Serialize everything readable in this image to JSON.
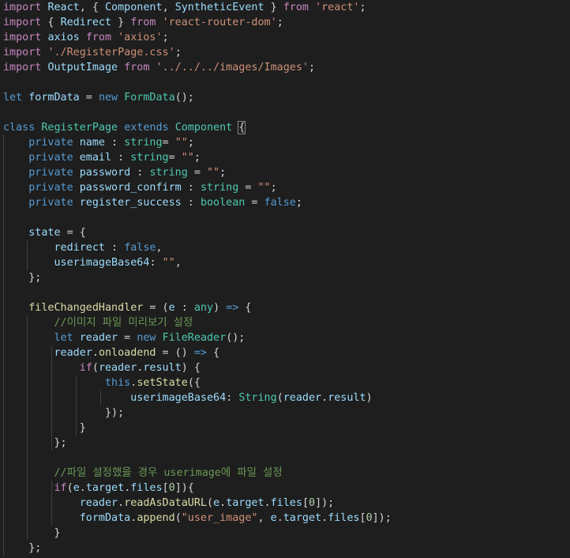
{
  "editor": {
    "lines": [
      [
        [
          "kw1",
          "import"
        ],
        [
          "pu",
          " "
        ],
        [
          "var",
          "React"
        ],
        [
          "pu",
          ", { "
        ],
        [
          "var",
          "Component"
        ],
        [
          "pu",
          ", "
        ],
        [
          "var",
          "SyntheticEvent"
        ],
        [
          "pu",
          " } "
        ],
        [
          "kw1",
          "from"
        ],
        [
          "pu",
          " "
        ],
        [
          "str",
          "'react'"
        ],
        [
          "pu",
          ";"
        ]
      ],
      [
        [
          "kw1",
          "import"
        ],
        [
          "pu",
          " { "
        ],
        [
          "var",
          "Redirect"
        ],
        [
          "pu",
          " } "
        ],
        [
          "kw1",
          "from"
        ],
        [
          "pu",
          " "
        ],
        [
          "str",
          "'react-router-dom'"
        ],
        [
          "pu",
          ";"
        ]
      ],
      [
        [
          "kw1",
          "import"
        ],
        [
          "pu",
          " "
        ],
        [
          "var",
          "axios"
        ],
        [
          "pu",
          " "
        ],
        [
          "kw1",
          "from"
        ],
        [
          "pu",
          " "
        ],
        [
          "str",
          "'axios'"
        ],
        [
          "pu",
          ";"
        ]
      ],
      [
        [
          "kw1",
          "import"
        ],
        [
          "pu",
          " "
        ],
        [
          "str",
          "'./RegisterPage.css'"
        ],
        [
          "pu",
          ";"
        ]
      ],
      [
        [
          "kw1",
          "import"
        ],
        [
          "pu",
          " "
        ],
        [
          "var",
          "OutputImage"
        ],
        [
          "pu",
          " "
        ],
        [
          "kw1",
          "from"
        ],
        [
          "pu",
          " "
        ],
        [
          "str",
          "'../../../images/Images'"
        ],
        [
          "pu",
          ";"
        ]
      ],
      [],
      [
        [
          "kw2",
          "let"
        ],
        [
          "pu",
          " "
        ],
        [
          "var",
          "formData"
        ],
        [
          "pu",
          " = "
        ],
        [
          "kw2",
          "new"
        ],
        [
          "pu",
          " "
        ],
        [
          "ty",
          "FormData"
        ],
        [
          "pu",
          "();"
        ]
      ],
      [],
      [
        [
          "kw2",
          "class"
        ],
        [
          "pu",
          " "
        ],
        [
          "ty",
          "RegisterPage"
        ],
        [
          "pu",
          " "
        ],
        [
          "kw2",
          "extends"
        ],
        [
          "pu",
          " "
        ],
        [
          "ty",
          "Component"
        ],
        [
          "pu",
          " "
        ],
        [
          "br",
          "{"
        ]
      ],
      [
        [
          "pu",
          "    "
        ],
        [
          "kw2",
          "private"
        ],
        [
          "pu",
          " "
        ],
        [
          "var",
          "name"
        ],
        [
          "pu",
          " : "
        ],
        [
          "ty",
          "string"
        ],
        [
          "pu",
          "= "
        ],
        [
          "str",
          "\"\""
        ],
        [
          "pu",
          ";"
        ]
      ],
      [
        [
          "pu",
          "    "
        ],
        [
          "kw2",
          "private"
        ],
        [
          "pu",
          " "
        ],
        [
          "var",
          "email"
        ],
        [
          "pu",
          " : "
        ],
        [
          "ty",
          "string"
        ],
        [
          "pu",
          "= "
        ],
        [
          "str",
          "\"\""
        ],
        [
          "pu",
          ";"
        ]
      ],
      [
        [
          "pu",
          "    "
        ],
        [
          "kw2",
          "private"
        ],
        [
          "pu",
          " "
        ],
        [
          "var",
          "password"
        ],
        [
          "pu",
          " : "
        ],
        [
          "ty",
          "string"
        ],
        [
          "pu",
          " = "
        ],
        [
          "str",
          "\"\""
        ],
        [
          "pu",
          ";"
        ]
      ],
      [
        [
          "pu",
          "    "
        ],
        [
          "kw2",
          "private"
        ],
        [
          "pu",
          " "
        ],
        [
          "var",
          "password_confirm"
        ],
        [
          "pu",
          " : "
        ],
        [
          "ty",
          "string"
        ],
        [
          "pu",
          " = "
        ],
        [
          "str",
          "\"\""
        ],
        [
          "pu",
          ";"
        ]
      ],
      [
        [
          "pu",
          "    "
        ],
        [
          "kw2",
          "private"
        ],
        [
          "pu",
          " "
        ],
        [
          "var",
          "register_success"
        ],
        [
          "pu",
          " : "
        ],
        [
          "ty",
          "boolean"
        ],
        [
          "pu",
          " = "
        ],
        [
          "kw2",
          "false"
        ],
        [
          "pu",
          ";"
        ]
      ],
      [],
      [
        [
          "pu",
          "    "
        ],
        [
          "var",
          "state"
        ],
        [
          "pu",
          " = {"
        ]
      ],
      [
        [
          "pu",
          "        "
        ],
        [
          "var",
          "redirect"
        ],
        [
          "pu",
          " : "
        ],
        [
          "kw2",
          "false"
        ],
        [
          "pu",
          ","
        ]
      ],
      [
        [
          "pu",
          "        "
        ],
        [
          "var",
          "userimageBase64"
        ],
        [
          "pu",
          ": "
        ],
        [
          "str",
          "\"\""
        ],
        [
          "pu",
          ","
        ]
      ],
      [
        [
          "pu",
          "    };"
        ]
      ],
      [],
      [
        [
          "pu",
          "    "
        ],
        [
          "fn",
          "fileChangedHandler"
        ],
        [
          "pu",
          " = ("
        ],
        [
          "var",
          "e"
        ],
        [
          "pu",
          " : "
        ],
        [
          "ty",
          "any"
        ],
        [
          "pu",
          ") "
        ],
        [
          "kw2",
          "=>"
        ],
        [
          "pu",
          " {"
        ]
      ],
      [
        [
          "pu",
          "        "
        ],
        [
          "cm",
          "//이미지 파일 미리보기 설정"
        ]
      ],
      [
        [
          "pu",
          "        "
        ],
        [
          "kw2",
          "let"
        ],
        [
          "pu",
          " "
        ],
        [
          "var",
          "reader"
        ],
        [
          "pu",
          " = "
        ],
        [
          "kw2",
          "new"
        ],
        [
          "pu",
          " "
        ],
        [
          "ty",
          "FileReader"
        ],
        [
          "pu",
          "();"
        ]
      ],
      [
        [
          "pu",
          "        "
        ],
        [
          "var",
          "reader"
        ],
        [
          "pu",
          "."
        ],
        [
          "fn",
          "onloadend"
        ],
        [
          "pu",
          " = () "
        ],
        [
          "kw2",
          "=>"
        ],
        [
          "pu",
          " {"
        ]
      ],
      [
        [
          "pu",
          "            "
        ],
        [
          "kw1",
          "if"
        ],
        [
          "pu",
          "("
        ],
        [
          "var",
          "reader"
        ],
        [
          "pu",
          "."
        ],
        [
          "var",
          "result"
        ],
        [
          "pu",
          ") {"
        ]
      ],
      [
        [
          "pu",
          "                "
        ],
        [
          "kw2",
          "this"
        ],
        [
          "pu",
          "."
        ],
        [
          "fn",
          "setState"
        ],
        [
          "pu",
          "({"
        ]
      ],
      [
        [
          "pu",
          "                    "
        ],
        [
          "var",
          "userimageBase64"
        ],
        [
          "pu",
          ": "
        ],
        [
          "ty",
          "String"
        ],
        [
          "pu",
          "("
        ],
        [
          "var",
          "reader"
        ],
        [
          "pu",
          "."
        ],
        [
          "var",
          "result"
        ],
        [
          "pu",
          ")"
        ]
      ],
      [
        [
          "pu",
          "                });"
        ]
      ],
      [
        [
          "pu",
          "            }"
        ]
      ],
      [
        [
          "pu",
          "        };"
        ]
      ],
      [],
      [
        [
          "pu",
          "        "
        ],
        [
          "cm",
          "//파일 설정했을 경우 userimage에 파일 설정"
        ]
      ],
      [
        [
          "pu",
          "        "
        ],
        [
          "kw1",
          "if"
        ],
        [
          "pu",
          "("
        ],
        [
          "var",
          "e"
        ],
        [
          "pu",
          "."
        ],
        [
          "var",
          "target"
        ],
        [
          "pu",
          "."
        ],
        [
          "var",
          "files"
        ],
        [
          "pu",
          "["
        ],
        [
          "num",
          "0"
        ],
        [
          "pu",
          "]){"
        ]
      ],
      [
        [
          "pu",
          "            "
        ],
        [
          "var",
          "reader"
        ],
        [
          "pu",
          "."
        ],
        [
          "fn",
          "readAsDataURL"
        ],
        [
          "pu",
          "("
        ],
        [
          "var",
          "e"
        ],
        [
          "pu",
          "."
        ],
        [
          "var",
          "target"
        ],
        [
          "pu",
          "."
        ],
        [
          "var",
          "files"
        ],
        [
          "pu",
          "["
        ],
        [
          "num",
          "0"
        ],
        [
          "pu",
          "]);"
        ]
      ],
      [
        [
          "pu",
          "            "
        ],
        [
          "var",
          "formData"
        ],
        [
          "pu",
          "."
        ],
        [
          "fn",
          "append"
        ],
        [
          "pu",
          "("
        ],
        [
          "str",
          "\"user_image\""
        ],
        [
          "pu",
          ", "
        ],
        [
          "var",
          "e"
        ],
        [
          "pu",
          "."
        ],
        [
          "var",
          "target"
        ],
        [
          "pu",
          "."
        ],
        [
          "var",
          "files"
        ],
        [
          "pu",
          "["
        ],
        [
          "num",
          "0"
        ],
        [
          "pu",
          "]);"
        ]
      ],
      [
        [
          "pu",
          "        }"
        ]
      ],
      [
        [
          "pu",
          "    };"
        ]
      ]
    ]
  }
}
